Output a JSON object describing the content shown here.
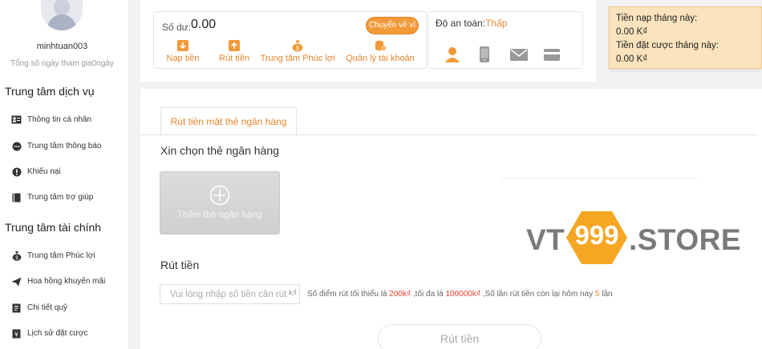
{
  "sidebar": {
    "username": "minhtuan003",
    "days_text": "Tổng số ngày tham gia0ngày",
    "service_title": "Trung tâm dịch vụ",
    "service_items": [
      {
        "label": "Thông tin cá nhân",
        "icon": "id-card-icon"
      },
      {
        "label": "Trung tâm thông báo",
        "icon": "chat-bubble-icon"
      },
      {
        "label": "Khiếu nại",
        "icon": "complaint-icon"
      },
      {
        "label": "Trung tâm trợ giúp",
        "icon": "book-icon"
      }
    ],
    "finance_title": "Trung tâm tài chính",
    "finance_items": [
      {
        "label": "Trung tâm Phúc lợi",
        "icon": "money-bag-icon"
      },
      {
        "label": "Hoa hồng khuyến mãi",
        "icon": "paper-plane-icon"
      },
      {
        "label": "Chi tiết quỹ",
        "icon": "ledger-icon"
      },
      {
        "label": "Lịch sử đặt cược",
        "icon": "bet-history-icon"
      }
    ]
  },
  "account": {
    "balance_label": "Số dư:",
    "balance_value": "0.00",
    "transfer_button": "Chuyển về ví",
    "actions": [
      {
        "label": "Nạp tiền",
        "icon": "deposit-icon"
      },
      {
        "label": "Rút tiền",
        "icon": "withdraw-icon"
      },
      {
        "label": "Trung tâm Phúc lợi",
        "icon": "money-bag-icon"
      },
      {
        "label": "Quản lý tài khoản",
        "icon": "account-manage-icon"
      }
    ]
  },
  "security": {
    "label": "Độ an toàn:",
    "level": "Thấp",
    "icons": [
      "user-icon",
      "phone-icon",
      "mail-icon",
      "bank-card-icon"
    ]
  },
  "monthly": {
    "deposit_label": "Tiền nạp tháng này:",
    "deposit_value": "0.00 K₫",
    "bet_label": "Tiền đặt cược tháng này:",
    "bet_value": "0.00 K₫"
  },
  "withdraw": {
    "tab_label": "Rút tiền mặt thẻ ngân hàng",
    "choose_card_label": "Xin chọn thẻ ngân hàng",
    "add_card_label": "Thêm thẻ ngân hàng",
    "section_label": "Rút tiền",
    "amount_placeholder": "Vui lòng nhập số tiền cần rút",
    "amount_unit": "k₫",
    "hint_prefix": "Số điểm rút tối thiểu là",
    "hint_min": "200k₫",
    "hint_mid": ",tối đa là",
    "hint_max": "100000k₫",
    "hint_times_prefix": ",Số lần rút tiền còn lại hôm nay",
    "hint_times": "5",
    "hint_times_suffix": "lần",
    "submit_button": "Rút tiền"
  },
  "watermark": {
    "prefix": "VT",
    "number": "999",
    "suffix": ".STORE"
  },
  "colors": {
    "accent_orange": "#e8852f",
    "warning_red": "#e8402f",
    "monthly_bg": "#fae3bd",
    "logo_orange": "#f5a623"
  }
}
